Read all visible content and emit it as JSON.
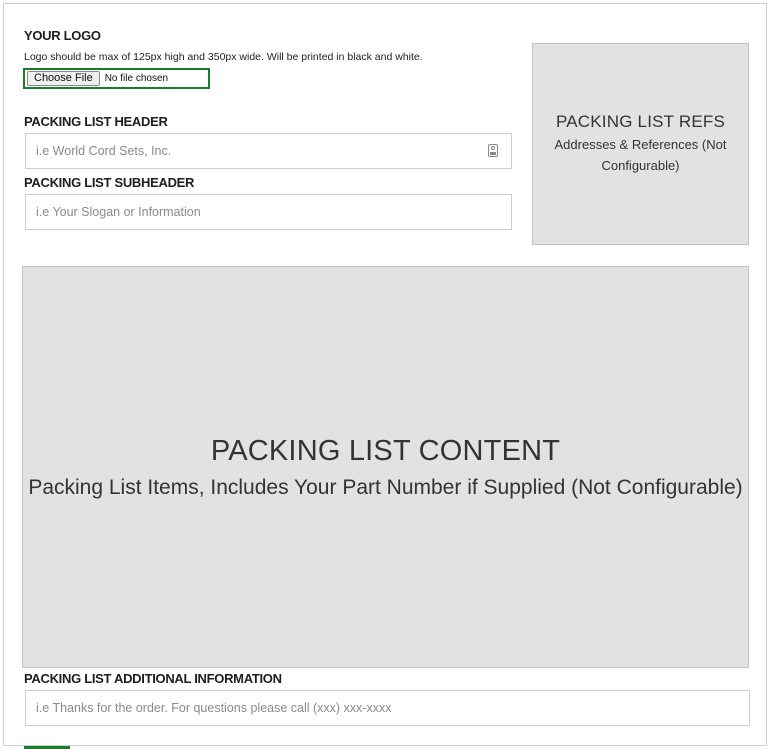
{
  "logo_section": {
    "label": "YOUR LOGO",
    "hint": "Logo should be max of 125px high and 350px wide. Will be printed in black and white.",
    "choose_file_label": "Choose File",
    "file_status": "No file chosen"
  },
  "header_field": {
    "label": "PACKING LIST HEADER",
    "placeholder": "i.e World Cord Sets, Inc.",
    "value": ""
  },
  "subheader_field": {
    "label": "PACKING LIST SUBHEADER",
    "placeholder": "i.e Your Slogan or Information",
    "value": ""
  },
  "refs_box": {
    "title": "PACKING LIST REFS",
    "subtitle": "Addresses & References (Not Configurable)"
  },
  "content_box": {
    "title": "PACKING LIST CONTENT",
    "subtitle": "Packing List Items, Includes Your Part Number if Supplied (Not Configurable)"
  },
  "additional_field": {
    "label": "PACKING LIST ADDITIONAL INFORMATION",
    "placeholder": "i.e Thanks for the order. For questions please call (xxx) xxx-xxxx",
    "value": ""
  },
  "colors": {
    "accent_green": "#1a7d2e",
    "placeholder_box_gray": "#e2e2e2",
    "border_gray": "#cfcfcf"
  },
  "icons": {
    "header_input_icon": "contact-card-icon"
  }
}
